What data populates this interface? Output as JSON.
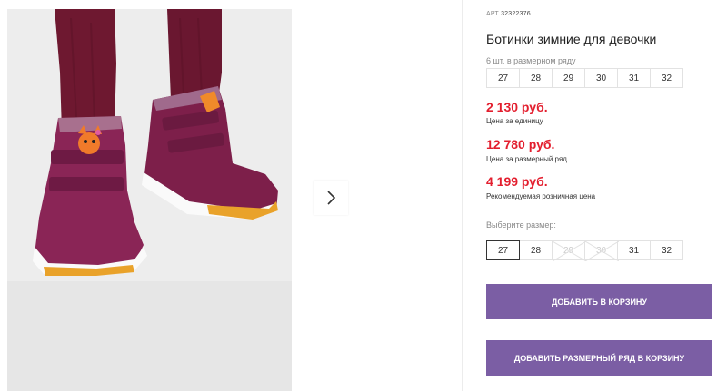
{
  "product": {
    "art_label": "АРТ",
    "art_number": "32322376",
    "title": "Ботинки зимние для девочки"
  },
  "series": {
    "caption": "6 шт. в размерном ряду",
    "sizes": [
      "27",
      "28",
      "29",
      "30",
      "31",
      "32"
    ]
  },
  "prices": {
    "unit_price": "2 130 руб.",
    "unit_caption": "Цена за единицу",
    "series_price": "12 780 руб.",
    "series_caption": "Цена за размерный ряд",
    "retail_price": "4 199 руб.",
    "retail_caption": "Рекомендуемая розничная цена"
  },
  "size_picker": {
    "caption": "Выберите размер:",
    "sizes": [
      {
        "label": "27",
        "state": "selected"
      },
      {
        "label": "28",
        "state": "available"
      },
      {
        "label": "29",
        "state": "unavailable"
      },
      {
        "label": "30",
        "state": "unavailable"
      },
      {
        "label": "31",
        "state": "available"
      },
      {
        "label": "32",
        "state": "available"
      }
    ]
  },
  "actions": {
    "add_to_cart": "Добавить в корзину",
    "add_series_to_cart": "Добавить размерный ряд в корзину"
  },
  "gallery": {
    "next_icon": "chevron-right-icon"
  },
  "colors": {
    "price": "#e31e2e",
    "button": "#7b5ea4",
    "boot": "#7d1f4a",
    "tights": "#6e1830"
  }
}
